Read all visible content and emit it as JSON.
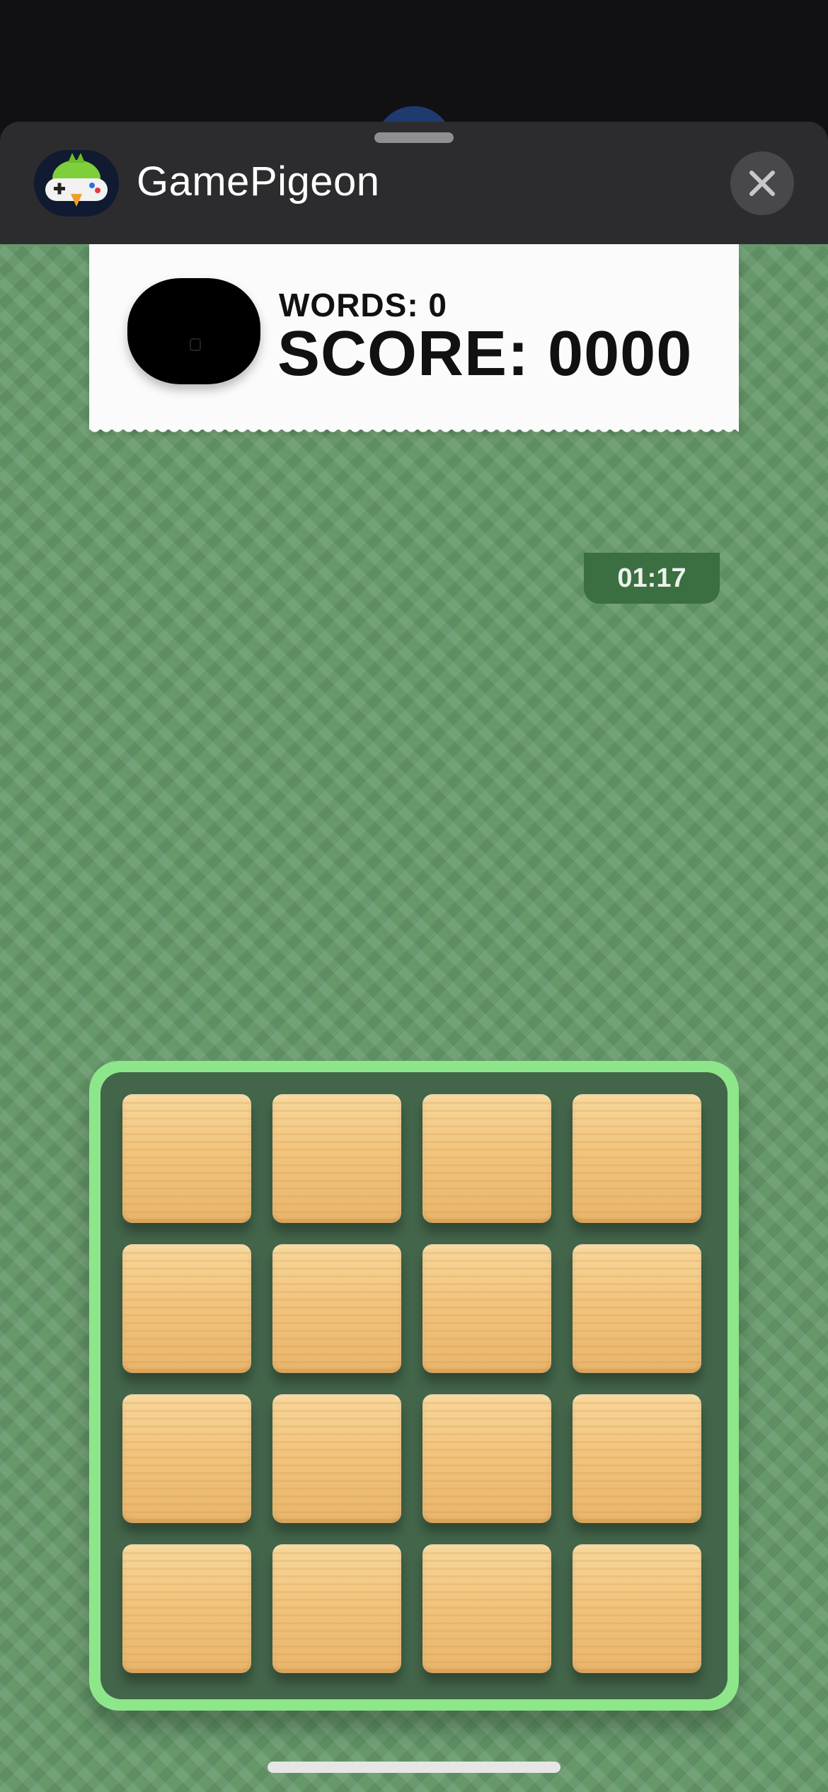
{
  "header": {
    "app_title": "GamePigeon",
    "app_icon": "gamepigeon-app-icon",
    "close_icon": "close-icon"
  },
  "scoreboard": {
    "words_label": "WORDS: 0",
    "score_label": "SCORE: 0000"
  },
  "timer": "01:17",
  "board": {
    "rows": 4,
    "columns": 4,
    "tiles": [
      "",
      "",
      "",
      "",
      "",
      "",
      "",
      "",
      "",
      "",
      "",
      "",
      "",
      "",
      "",
      ""
    ]
  },
  "colors": {
    "background": "#66986a",
    "board_frame": "#8ee68a",
    "board_inner": "#43654a",
    "tile": "#f2c47e",
    "timer_bg": "#3b6e41",
    "header_bg": "#2c2c2e"
  }
}
